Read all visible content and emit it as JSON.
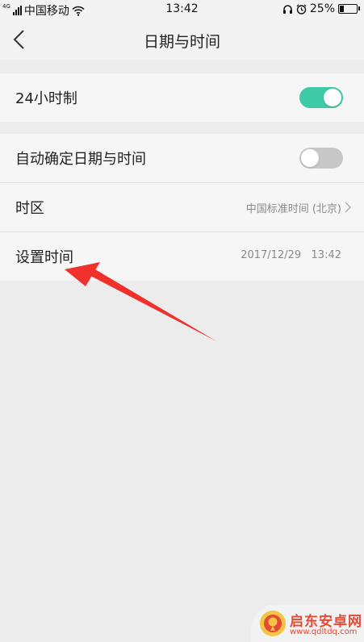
{
  "status_bar": {
    "network": "4G",
    "carrier": "中国移动",
    "time": "13:42",
    "battery_percent": "25%",
    "battery_level": 0.25,
    "icons": [
      "signal-icon",
      "wifi-icon",
      "headset-icon",
      "alarm-icon",
      "battery-icon"
    ]
  },
  "header": {
    "title": "日期与时间",
    "back_icon": "chevron-left-icon"
  },
  "section_one": {
    "rows": [
      {
        "label": "24小时制",
        "toggle_on": true
      }
    ]
  },
  "section_two": {
    "rows": [
      {
        "label": "自动确定日期与时间",
        "toggle_on": false
      },
      {
        "label": "时区",
        "value": "中国标准时间 (北京)"
      },
      {
        "label": "设置时间",
        "value": "2017/12/29   13:42"
      }
    ]
  },
  "colors": {
    "accent": "#3ec9a7",
    "toggle_off": "#c8c8c8",
    "annotation_arrow": "#f0302a",
    "background": "#ececec"
  },
  "watermark": {
    "name": "启东安卓网",
    "url": "www.qdltdq.com"
  }
}
